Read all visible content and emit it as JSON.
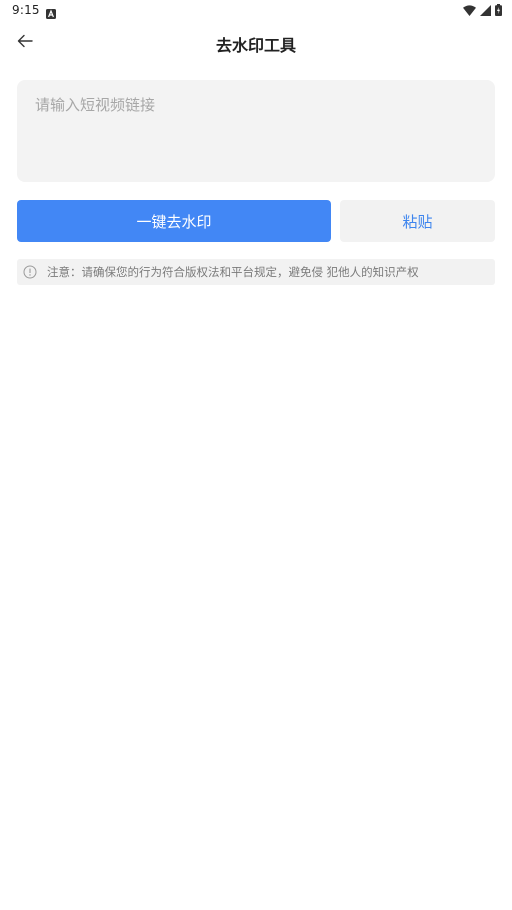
{
  "status_bar": {
    "time": "9:15"
  },
  "header": {
    "title": "去水印工具"
  },
  "input": {
    "placeholder": "请输入短视频链接",
    "value": ""
  },
  "actions": {
    "remove_watermark_label": "一键去水印",
    "paste_label": "粘贴"
  },
  "notice": {
    "text": "注意：请确保您的行为符合版权法和平台规定，避免侵 犯他人的知识产权"
  },
  "colors": {
    "primary": "#4287f5",
    "paste_text": "#3e85ee",
    "input_bg": "#f3f3f3",
    "notice_bg": "#f2f2f2"
  },
  "icons": {
    "back": "arrow-left-icon",
    "notification": "a-letter-icon",
    "wifi": "wifi-icon",
    "signal": "signal-icon",
    "battery": "battery-charging-icon",
    "notice": "info-circle-icon"
  }
}
